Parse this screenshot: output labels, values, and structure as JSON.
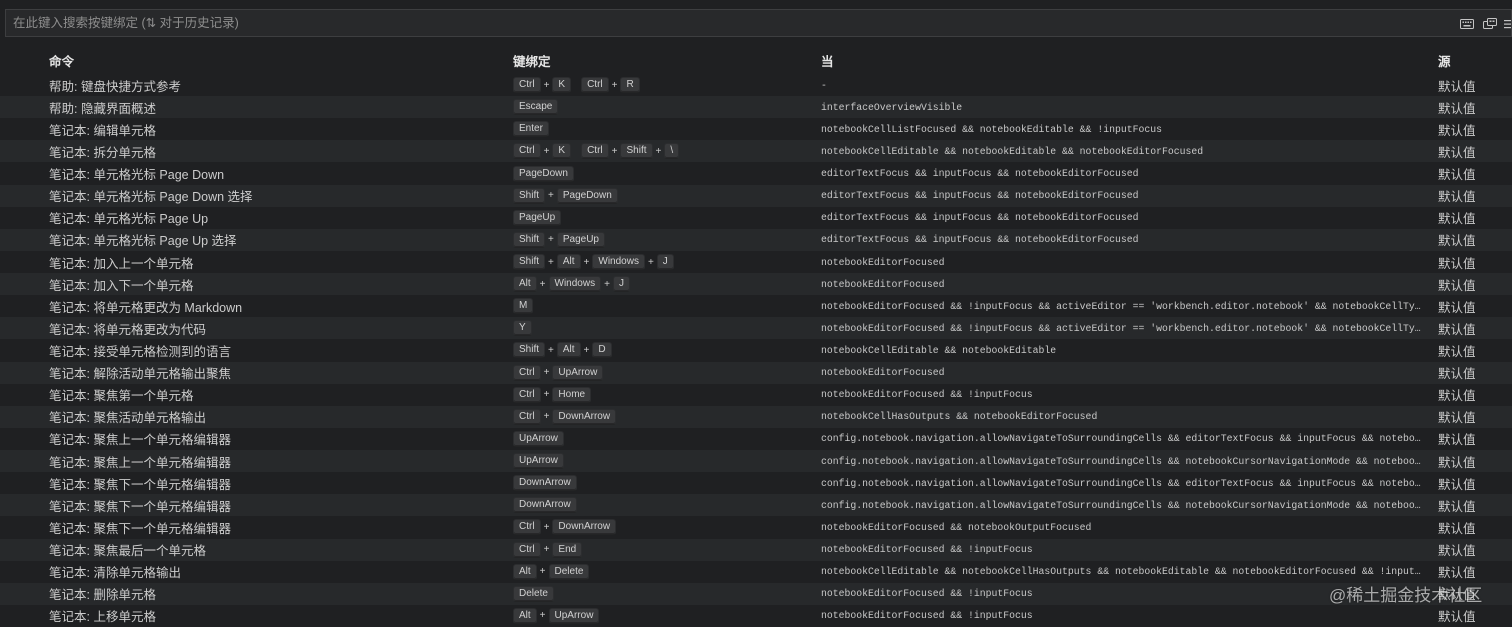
{
  "colors": {
    "background": "#1f2022",
    "row_alt": "#27292b",
    "search_bg": "#28292b",
    "text": "#cccccc",
    "keycap_bg": "#38393b"
  },
  "search": {
    "placeholder": "在此键入搜索按键绑定 (⇅ 对于历史记录)",
    "icons": [
      "keyboard-icon",
      "sort-precedence-icon",
      "list-icon"
    ]
  },
  "table": {
    "headers": {
      "command": "命令",
      "keybinding": "键绑定",
      "when": "当",
      "source": "源"
    },
    "key_separator": "+",
    "rows": [
      {
        "command": "帮助: 键盘快捷方式参考",
        "keys": [
          [
            "Ctrl",
            "K"
          ],
          [
            "Ctrl",
            "R"
          ]
        ],
        "when": "-",
        "source": "默认值"
      },
      {
        "command": "帮助: 隐藏界面概述",
        "keys": [
          [
            "Escape"
          ]
        ],
        "when": "interfaceOverviewVisible",
        "source": "默认值"
      },
      {
        "command": "笔记本: 编辑单元格",
        "keys": [
          [
            "Enter"
          ]
        ],
        "when": "notebookCellListFocused && notebookEditable && !inputFocus",
        "source": "默认值"
      },
      {
        "command": "笔记本: 拆分单元格",
        "keys": [
          [
            "Ctrl",
            "K"
          ],
          [
            "Ctrl",
            "Shift",
            "\\"
          ]
        ],
        "when": "notebookCellEditable && notebookEditable && notebookEditorFocused",
        "source": "默认值"
      },
      {
        "command": "笔记本: 单元格光标 Page Down",
        "keys": [
          [
            "PageDown"
          ]
        ],
        "when": "editorTextFocus && inputFocus && notebookEditorFocused",
        "source": "默认值"
      },
      {
        "command": "笔记本: 单元格光标 Page Down 选择",
        "keys": [
          [
            "Shift",
            "PageDown"
          ]
        ],
        "when": "editorTextFocus && inputFocus && notebookEditorFocused",
        "source": "默认值"
      },
      {
        "command": "笔记本: 单元格光标 Page Up",
        "keys": [
          [
            "PageUp"
          ]
        ],
        "when": "editorTextFocus && inputFocus && notebookEditorFocused",
        "source": "默认值"
      },
      {
        "command": "笔记本: 单元格光标 Page Up 选择",
        "keys": [
          [
            "Shift",
            "PageUp"
          ]
        ],
        "when": "editorTextFocus && inputFocus && notebookEditorFocused",
        "source": "默认值"
      },
      {
        "command": "笔记本: 加入上一个单元格",
        "keys": [
          [
            "Shift",
            "Alt",
            "Windows",
            "J"
          ]
        ],
        "when": "notebookEditorFocused",
        "source": "默认值"
      },
      {
        "command": "笔记本: 加入下一个单元格",
        "keys": [
          [
            "Alt",
            "Windows",
            "J"
          ]
        ],
        "when": "notebookEditorFocused",
        "source": "默认值"
      },
      {
        "command": "笔记本: 将单元格更改为 Markdown",
        "keys": [
          [
            "M"
          ]
        ],
        "when": "notebookEditorFocused && !inputFocus && activeEditor == 'workbench.editor.notebook' && notebookCellTy…",
        "source": "默认值"
      },
      {
        "command": "笔记本: 将单元格更改为代码",
        "keys": [
          [
            "Y"
          ]
        ],
        "when": "notebookEditorFocused && !inputFocus && activeEditor == 'workbench.editor.notebook' && notebookCellTy…",
        "source": "默认值"
      },
      {
        "command": "笔记本: 接受单元格检测到的语言",
        "keys": [
          [
            "Shift",
            "Alt",
            "D"
          ]
        ],
        "when": "notebookCellEditable && notebookEditable",
        "source": "默认值"
      },
      {
        "command": "笔记本: 解除活动单元格输出聚焦",
        "keys": [
          [
            "Ctrl",
            "UpArrow"
          ]
        ],
        "when": "notebookEditorFocused",
        "source": "默认值"
      },
      {
        "command": "笔记本: 聚焦第一个单元格",
        "keys": [
          [
            "Ctrl",
            "Home"
          ]
        ],
        "when": "notebookEditorFocused && !inputFocus",
        "source": "默认值"
      },
      {
        "command": "笔记本: 聚焦活动单元格输出",
        "keys": [
          [
            "Ctrl",
            "DownArrow"
          ]
        ],
        "when": "notebookCellHasOutputs && notebookEditorFocused",
        "source": "默认值"
      },
      {
        "command": "笔记本: 聚焦上一个单元格编辑器",
        "keys": [
          [
            "UpArrow"
          ]
        ],
        "when": "config.notebook.navigation.allowNavigateToSurroundingCells && editorTextFocus && inputFocus && notebo…",
        "source": "默认值"
      },
      {
        "command": "笔记本: 聚焦上一个单元格编辑器",
        "keys": [
          [
            "UpArrow"
          ]
        ],
        "when": "config.notebook.navigation.allowNavigateToSurroundingCells && notebookCursorNavigationMode && noteboo…",
        "source": "默认值"
      },
      {
        "command": "笔记本: 聚焦下一个单元格编辑器",
        "keys": [
          [
            "DownArrow"
          ]
        ],
        "when": "config.notebook.navigation.allowNavigateToSurroundingCells && editorTextFocus && inputFocus && notebo…",
        "source": "默认值"
      },
      {
        "command": "笔记本: 聚焦下一个单元格编辑器",
        "keys": [
          [
            "DownArrow"
          ]
        ],
        "when": "config.notebook.navigation.allowNavigateToSurroundingCells && notebookCursorNavigationMode && noteboo…",
        "source": "默认值"
      },
      {
        "command": "笔记本: 聚焦下一个单元格编辑器",
        "keys": [
          [
            "Ctrl",
            "DownArrow"
          ]
        ],
        "when": "notebookEditorFocused && notebookOutputFocused",
        "source": "默认值"
      },
      {
        "command": "笔记本: 聚焦最后一个单元格",
        "keys": [
          [
            "Ctrl",
            "End"
          ]
        ],
        "when": "notebookEditorFocused && !inputFocus",
        "source": "默认值"
      },
      {
        "command": "笔记本: 清除单元格输出",
        "keys": [
          [
            "Alt",
            "Delete"
          ]
        ],
        "when": "notebookCellEditable && notebookCellHasOutputs && notebookEditable && notebookEditorFocused && !input…",
        "source": "默认值"
      },
      {
        "command": "笔记本: 删除单元格",
        "keys": [
          [
            "Delete"
          ]
        ],
        "when": "notebookEditorFocused && !inputFocus",
        "source": "默认值"
      },
      {
        "command": "笔记本: 上移单元格",
        "keys": [
          [
            "Alt",
            "UpArrow"
          ]
        ],
        "when": "notebookEditorFocused && !inputFocus",
        "source": "默认值"
      }
    ]
  },
  "watermark": "@稀土掘金技术社区"
}
